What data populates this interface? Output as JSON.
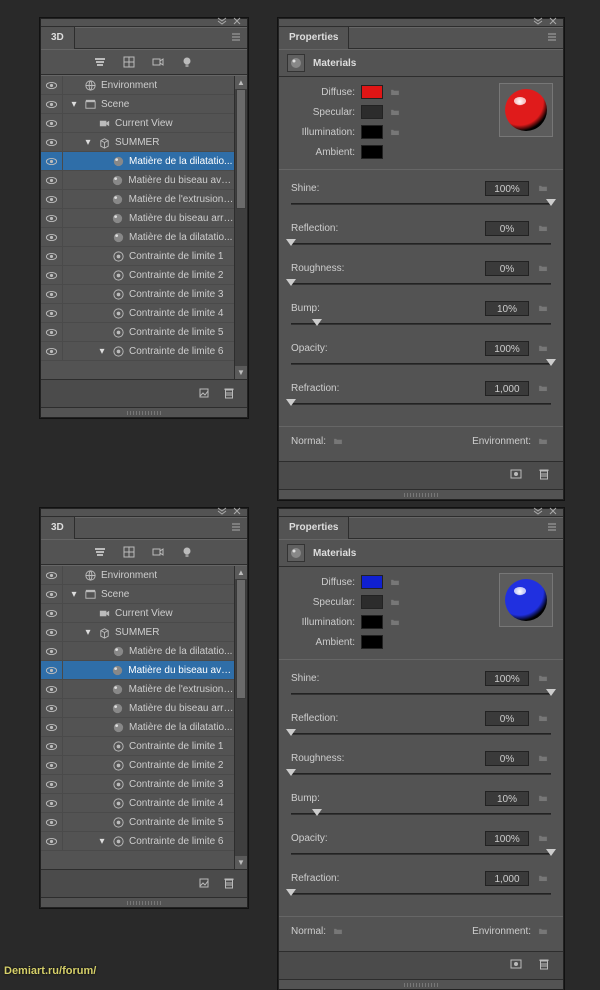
{
  "watermark": "Demiart.ru/forum/",
  "panels": [
    {
      "tree": {
        "tab": "3D",
        "rows": [
          {
            "indent": 0,
            "twist": "",
            "icon": "env",
            "label": "Environment",
            "sel": false,
            "eye": true
          },
          {
            "indent": 0,
            "twist": "▾",
            "icon": "scene",
            "label": "Scene",
            "sel": false,
            "eye": true
          },
          {
            "indent": 1,
            "twist": "",
            "icon": "cam",
            "label": "Current View",
            "sel": false,
            "eye": true
          },
          {
            "indent": 1,
            "twist": "▾",
            "icon": "mesh",
            "label": "SUMMER",
            "sel": false,
            "eye": true
          },
          {
            "indent": 2,
            "twist": "",
            "icon": "mat",
            "label": "Matière de la dilatatio...",
            "sel": true,
            "eye": true
          },
          {
            "indent": 2,
            "twist": "",
            "icon": "mat",
            "label": "Matière du biseau ava...",
            "sel": false,
            "eye": true
          },
          {
            "indent": 2,
            "twist": "",
            "icon": "mat",
            "label": "Matière de l'extrusion ...",
            "sel": false,
            "eye": true
          },
          {
            "indent": 2,
            "twist": "",
            "icon": "mat",
            "label": "Matière du biseau arri...",
            "sel": false,
            "eye": true
          },
          {
            "indent": 2,
            "twist": "",
            "icon": "mat",
            "label": "Matière de la dilatatio...",
            "sel": false,
            "eye": true
          },
          {
            "indent": 2,
            "twist": "",
            "icon": "cons",
            "label": "Contrainte de limite 1",
            "sel": false,
            "eye": true
          },
          {
            "indent": 2,
            "twist": "",
            "icon": "cons",
            "label": "Contrainte de limite 2",
            "sel": false,
            "eye": true
          },
          {
            "indent": 2,
            "twist": "",
            "icon": "cons",
            "label": "Contrainte de limite 3",
            "sel": false,
            "eye": true
          },
          {
            "indent": 2,
            "twist": "",
            "icon": "cons",
            "label": "Contrainte de limite 4",
            "sel": false,
            "eye": true
          },
          {
            "indent": 2,
            "twist": "",
            "icon": "cons",
            "label": "Contrainte de limite 5",
            "sel": false,
            "eye": true
          },
          {
            "indent": 2,
            "twist": "▾",
            "icon": "cons",
            "label": "Contrainte de limite 6",
            "sel": false,
            "eye": true
          }
        ],
        "scroll": {
          "thumbTop": 0,
          "thumbH": 120
        }
      },
      "props": {
        "tab": "Properties",
        "title": "Materials",
        "swatches": {
          "diffuse": {
            "label": "Diffuse:",
            "color": "#e01515"
          },
          "specular": {
            "label": "Specular:",
            "color": "#2c2c2c"
          },
          "illumination": {
            "label": "Illumination:",
            "color": "#000000"
          },
          "ambient": {
            "label": "Ambient:",
            "color": "#000000"
          }
        },
        "preview": {
          "type": "sphere",
          "color": "#e01b1b"
        },
        "sliders": {
          "shine": {
            "label": "Shine:",
            "value": "100%",
            "pos": 100
          },
          "reflection": {
            "label": "Reflection:",
            "value": "0%",
            "pos": 0
          },
          "roughness": {
            "label": "Roughness:",
            "value": "0%",
            "pos": 0
          },
          "bump": {
            "label": "Bump:",
            "value": "10%",
            "pos": 10
          },
          "opacity": {
            "label": "Opacity:",
            "value": "100%",
            "pos": 100
          },
          "refraction": {
            "label": "Refraction:",
            "value": "1,000",
            "pos": 0
          }
        },
        "normal": {
          "label": "Normal:"
        },
        "environment": {
          "label": "Environment:"
        }
      }
    },
    {
      "tree": {
        "tab": "3D",
        "rows": [
          {
            "indent": 0,
            "twist": "",
            "icon": "env",
            "label": "Environment",
            "sel": false,
            "eye": true
          },
          {
            "indent": 0,
            "twist": "▾",
            "icon": "scene",
            "label": "Scene",
            "sel": false,
            "eye": true
          },
          {
            "indent": 1,
            "twist": "",
            "icon": "cam",
            "label": "Current View",
            "sel": false,
            "eye": true
          },
          {
            "indent": 1,
            "twist": "▾",
            "icon": "mesh",
            "label": "SUMMER",
            "sel": false,
            "eye": true
          },
          {
            "indent": 2,
            "twist": "",
            "icon": "mat",
            "label": "Matière de la dilatatio...",
            "sel": false,
            "eye": true
          },
          {
            "indent": 2,
            "twist": "",
            "icon": "mat",
            "label": "Matière du biseau ava...",
            "sel": true,
            "eye": true
          },
          {
            "indent": 2,
            "twist": "",
            "icon": "mat",
            "label": "Matière de l'extrusion ...",
            "sel": false,
            "eye": true
          },
          {
            "indent": 2,
            "twist": "",
            "icon": "mat",
            "label": "Matière du biseau arri...",
            "sel": false,
            "eye": true
          },
          {
            "indent": 2,
            "twist": "",
            "icon": "mat",
            "label": "Matière de la dilatatio...",
            "sel": false,
            "eye": true
          },
          {
            "indent": 2,
            "twist": "",
            "icon": "cons",
            "label": "Contrainte de limite 1",
            "sel": false,
            "eye": true
          },
          {
            "indent": 2,
            "twist": "",
            "icon": "cons",
            "label": "Contrainte de limite 2",
            "sel": false,
            "eye": true
          },
          {
            "indent": 2,
            "twist": "",
            "icon": "cons",
            "label": "Contrainte de limite 3",
            "sel": false,
            "eye": true
          },
          {
            "indent": 2,
            "twist": "",
            "icon": "cons",
            "label": "Contrainte de limite 4",
            "sel": false,
            "eye": true
          },
          {
            "indent": 2,
            "twist": "",
            "icon": "cons",
            "label": "Contrainte de limite 5",
            "sel": false,
            "eye": true
          },
          {
            "indent": 2,
            "twist": "▾",
            "icon": "cons",
            "label": "Contrainte de limite 6",
            "sel": false,
            "eye": true
          }
        ],
        "scroll": {
          "thumbTop": 0,
          "thumbH": 120
        }
      },
      "props": {
        "tab": "Properties",
        "title": "Materials",
        "swatches": {
          "diffuse": {
            "label": "Diffuse:",
            "color": "#1020d0"
          },
          "specular": {
            "label": "Specular:",
            "color": "#2c2c2c"
          },
          "illumination": {
            "label": "Illumination:",
            "color": "#000000"
          },
          "ambient": {
            "label": "Ambient:",
            "color": "#000000"
          }
        },
        "preview": {
          "type": "sphere",
          "color": "#2030e0"
        },
        "sliders": {
          "shine": {
            "label": "Shine:",
            "value": "100%",
            "pos": 100
          },
          "reflection": {
            "label": "Reflection:",
            "value": "0%",
            "pos": 0
          },
          "roughness": {
            "label": "Roughness:",
            "value": "0%",
            "pos": 0
          },
          "bump": {
            "label": "Bump:",
            "value": "10%",
            "pos": 10
          },
          "opacity": {
            "label": "Opacity:",
            "value": "100%",
            "pos": 100
          },
          "refraction": {
            "label": "Refraction:",
            "value": "1,000",
            "pos": 0
          }
        },
        "normal": {
          "label": "Normal:"
        },
        "environment": {
          "label": "Environment:"
        }
      }
    }
  ]
}
